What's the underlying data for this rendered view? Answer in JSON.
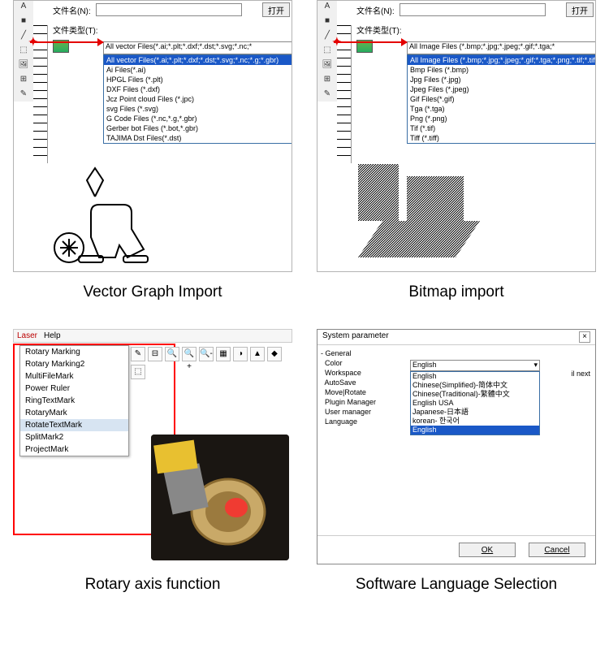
{
  "captions": {
    "vector": "Vector Graph Import",
    "bitmap": "Bitmap import",
    "rotary": "Rotary axis function",
    "lang": "Software Language Selection"
  },
  "filedialog": {
    "filename_label": "文件名(N):",
    "filetype_label": "文件类型(T):",
    "open_btn": "打开"
  },
  "vector": {
    "selected": "All vector Files(*.ai;*.plt;*.dxf;*.dst;*.svg;*.nc;*",
    "options": [
      "All vector Files(*.ai;*.plt;*.dxf;*.dst;*.svg;*.nc;*.g;*.gbr)",
      "Ai Files(*.ai)",
      "HPGL Files (*.plt)",
      "DXF Files (*.dxf)",
      "Jcz Point cloud Files (*.jpc)",
      "svg Files (*.svg)",
      "G Code Files (*.nc,*.g,*.gbr)",
      "Gerber bot Files (*.bot,*.gbr)",
      "TAJIMA Dst Files(*.dst)"
    ]
  },
  "bitmap": {
    "selected": "All Image Files (*.bmp;*.jpg;*.jpeg;*.gif;*.tga;*",
    "options": [
      "All Image Files (*.bmp;*.jpg;*.jpeg;*.gif;*.tga;*.png;*.tif;*.tiff)",
      "Bmp Files (*.bmp)",
      "Jpg Files (*.jpg)",
      "Jpeg Files (*.jpeg)",
      "Gif Files(*.gif)",
      "Tga (*.tga)",
      "Png (*.png)",
      "Tif (*.tif)",
      "Tiff (*.tiff)"
    ]
  },
  "rotary": {
    "menubar": [
      "Laser",
      "Help"
    ],
    "items": [
      "Rotary Marking",
      "Rotary Marking2",
      "MultiFileMark",
      "Power Ruler",
      "RingTextMark",
      "RotaryMark",
      "RotateTextMark",
      "SplitMark2",
      "ProjectMark"
    ],
    "selected_index": 6
  },
  "sysparam": {
    "title": "System parameter",
    "tree": [
      "- General",
      "  Color",
      "  Workspace",
      "  AutoSave",
      "  Move|Rotate",
      "  Plugin Manager",
      "  User manager",
      "  Language"
    ],
    "dd_selected": "English",
    "dd_items": [
      "English",
      "Chinese(Simplified)-简体中文",
      "Chinese(Traditional)-繁體中文",
      "English USA",
      "Japanese-日本語",
      "korean- 한국어",
      "English"
    ],
    "dd_selected_index": 6,
    "note": "il next",
    "ok": "OK",
    "cancel": "Cancel"
  }
}
